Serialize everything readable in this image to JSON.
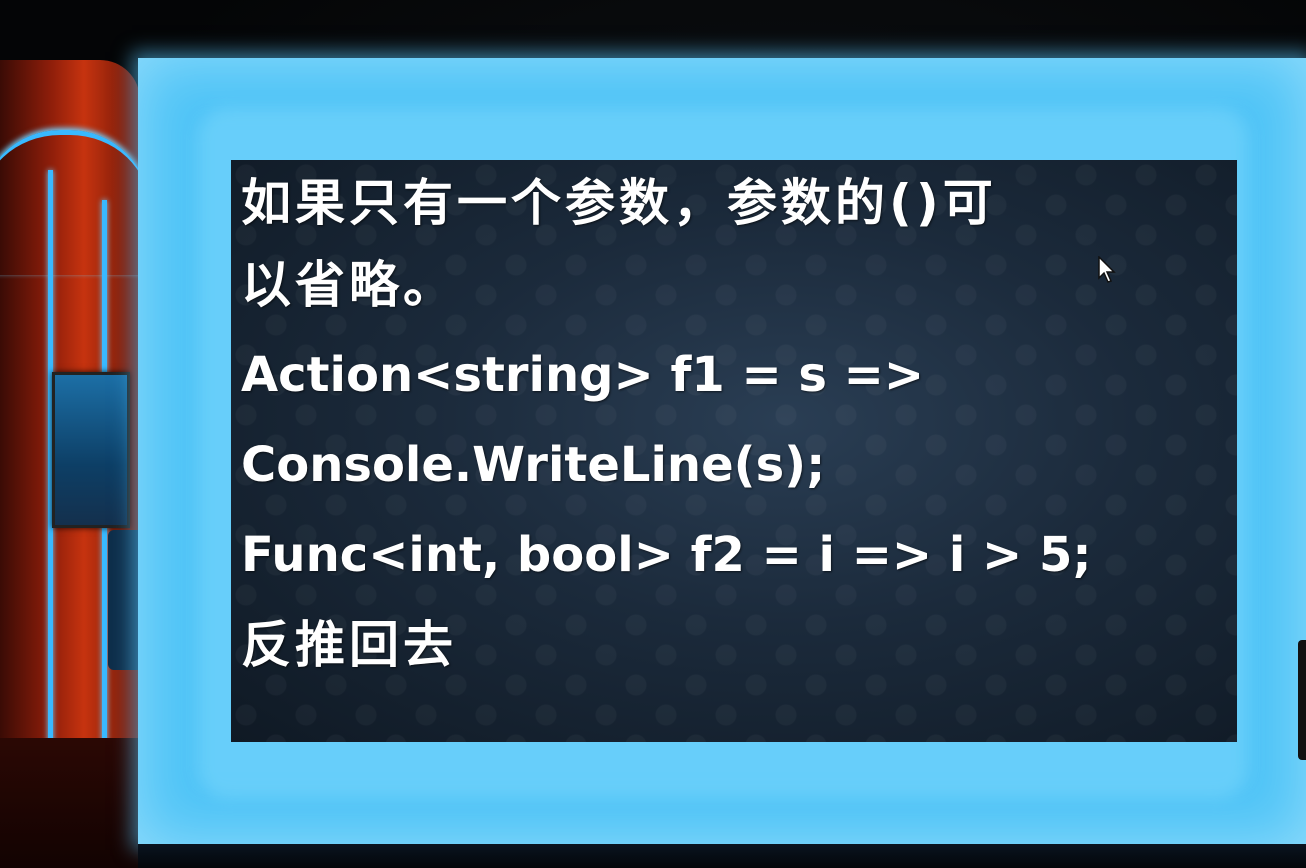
{
  "slide": {
    "lines": [
      "如果只有一个参数，参数的()可",
      "以省略。",
      "Action<string> f1 = s =>",
      "Console.WriteLine(s);",
      "Func<int, bool> f2 = i => i > 5;",
      "反推回去"
    ]
  },
  "colors": {
    "screen_glow": "#4fc4f7",
    "slide_bg": "#1b2a3b",
    "text": "#ffffff",
    "set_red": "#c6330f",
    "set_stripe": "#39b9ff"
  },
  "icons": {
    "cursor": "mouse-pointer-icon"
  }
}
